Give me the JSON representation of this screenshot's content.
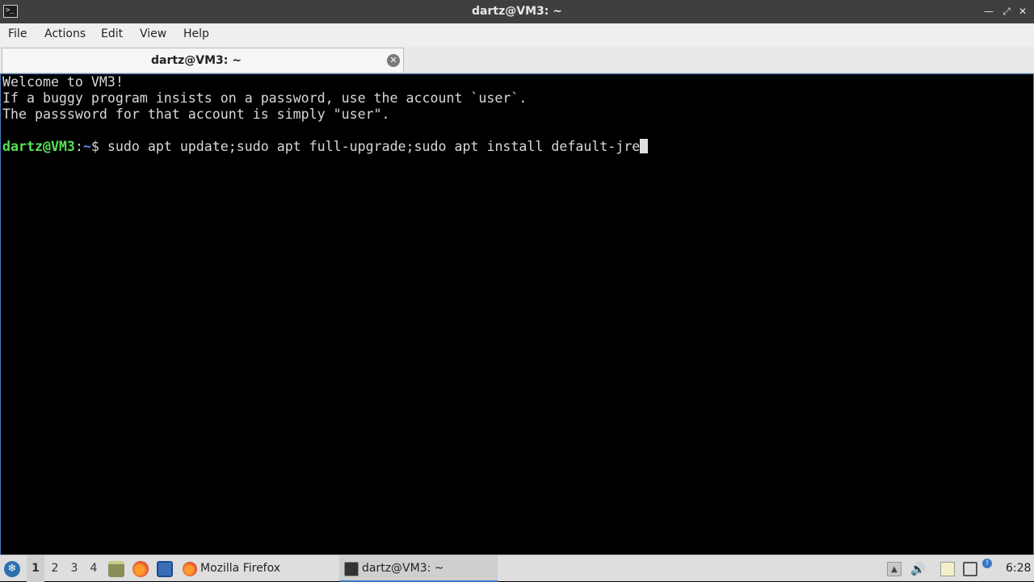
{
  "window": {
    "title": "dartz@VM3: ~",
    "icon": "terminal-icon",
    "controls": [
      "minimize-icon",
      "restore-icon",
      "close-icon"
    ]
  },
  "menu": {
    "file": "File",
    "actions": "Actions",
    "edit": "Edit",
    "view": "View",
    "help": "Help"
  },
  "tabs": [
    {
      "label": "dartz@VM3: ~",
      "close_icon": "close-circle-icon"
    }
  ],
  "terminal": {
    "lines": [
      "Welcome to VM3!",
      "If a buggy program insists on a password, use the account `user`.",
      "The passsword for that account is simply \"user\"."
    ],
    "prompt_user": "dartz@VM3",
    "prompt_colon": ":",
    "prompt_path": "~",
    "prompt_symbol": "$ ",
    "command": "sudo apt update;sudo apt full-upgrade;sudo apt install default-jre"
  },
  "taskbar": {
    "start_icon": "lxqt-menu-icon",
    "desktops": [
      "1",
      "2",
      "3",
      "4"
    ],
    "active_desktop": "1",
    "quicklaunch": [
      "file-manager-icon",
      "firefox-icon",
      "show-desktop-icon"
    ],
    "tasks": [
      {
        "label": "Mozilla Firefox",
        "icon": "firefox-icon"
      },
      {
        "label": "dartz@VM3: ~",
        "icon": "terminal-icon"
      }
    ],
    "tray": [
      "upload-icon",
      "volume-icon",
      "clipboard-icon",
      "network-icon",
      "update-notifier-icon"
    ],
    "clock": "6:28"
  },
  "colors": {
    "prompt_user": "#55e055",
    "prompt_path": "#5c86e8",
    "terminal_bg": "#000000",
    "titlebar_bg": "#3f3f3f"
  }
}
